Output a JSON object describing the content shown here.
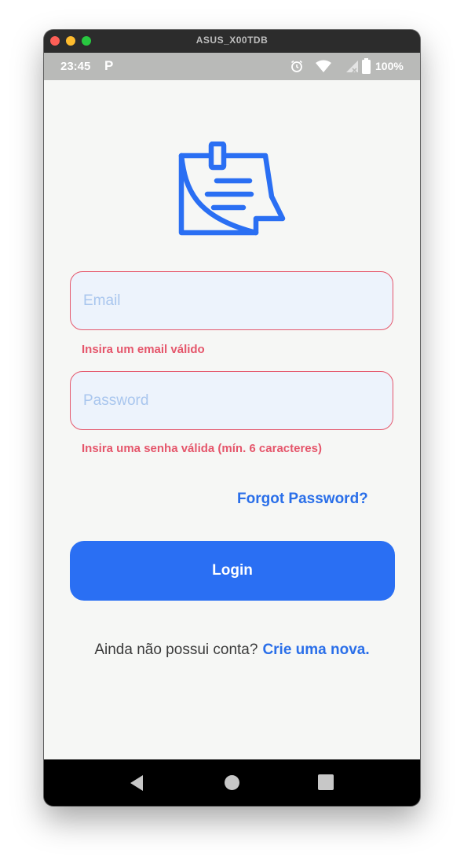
{
  "window": {
    "title": "ASUS_X00TDB"
  },
  "status_bar": {
    "time": "23:45",
    "app_icon": "P",
    "battery_text": "100%",
    "icons": [
      "alarm-icon",
      "wifi-icon",
      "signal-icon",
      "battery-icon"
    ]
  },
  "app": {
    "logo_icon": "sticky-note-icon",
    "email": {
      "placeholder": "Email",
      "value": "",
      "error": "Insira um email válido"
    },
    "password": {
      "placeholder": "Password",
      "value": "",
      "error": "Insira uma senha válida (mín. 6 caracteres)"
    },
    "forgot_label": "Forgot Password?",
    "login_label": "Login",
    "signup_prompt": "Ainda não possui conta?",
    "signup_link": "Crie uma nova."
  },
  "nav_bar": {
    "buttons": [
      "back-icon",
      "home-icon",
      "recents-icon"
    ]
  },
  "colors": {
    "primary": "#2a6ff3",
    "error": "#e5566b",
    "input_background": "#edf3fc",
    "screen_background": "#f6f7f5"
  }
}
